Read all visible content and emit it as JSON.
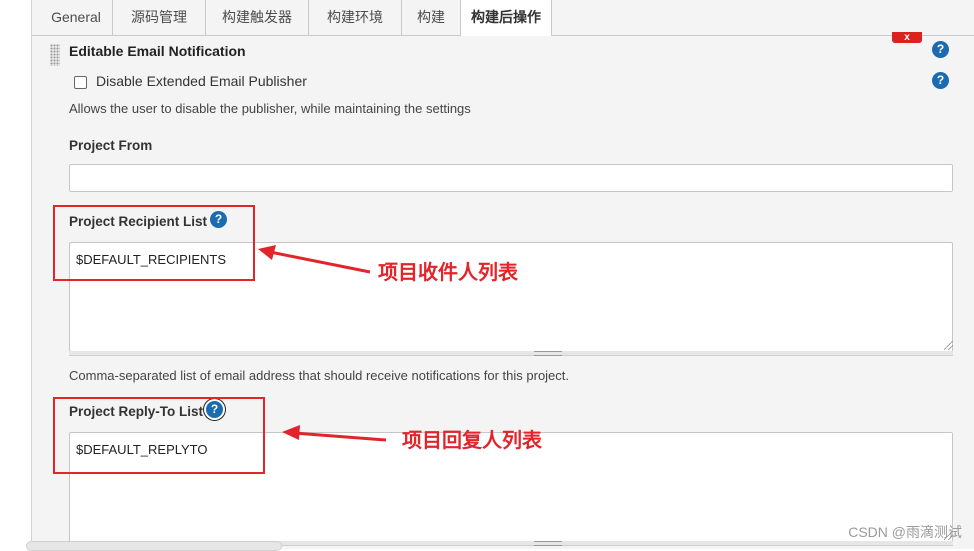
{
  "tabs": [
    {
      "label": "General",
      "active": false
    },
    {
      "label": "源码管理",
      "active": false
    },
    {
      "label": "构建触发器",
      "active": false
    },
    {
      "label": "构建环境",
      "active": false
    },
    {
      "label": "构建",
      "active": false
    },
    {
      "label": "构建后操作",
      "active": true
    }
  ],
  "section": {
    "title": "Editable Email Notification",
    "delete_label": "x",
    "help_glyph": "?"
  },
  "disable_publisher": {
    "label": "Disable Extended Email Publisher",
    "checked": false,
    "description": "Allows the user to disable the publisher, while maintaining the settings"
  },
  "project_from": {
    "label": "Project From",
    "value": ""
  },
  "recipient_list": {
    "label": "Project Recipient List",
    "value": "$DEFAULT_RECIPIENTS",
    "description": "Comma-separated list of email address that should receive notifications for this project."
  },
  "reply_to_list": {
    "label": "Project Reply-To List",
    "value": "$DEFAULT_REPLYTO"
  },
  "annotations": {
    "recipient_note": "项目收件人列表",
    "reply_to_note": "项目回复人列表",
    "color": "#e3242b"
  },
  "watermark": "CSDN @雨滴测试",
  "icons": {
    "help": "help-circle-icon",
    "drag": "drag-handle-icon",
    "delete": "close-icon"
  },
  "colors": {
    "help_blue": "#1a6bb0",
    "delete_red": "#d9231e",
    "panel_bg": "#f4f4f4"
  }
}
